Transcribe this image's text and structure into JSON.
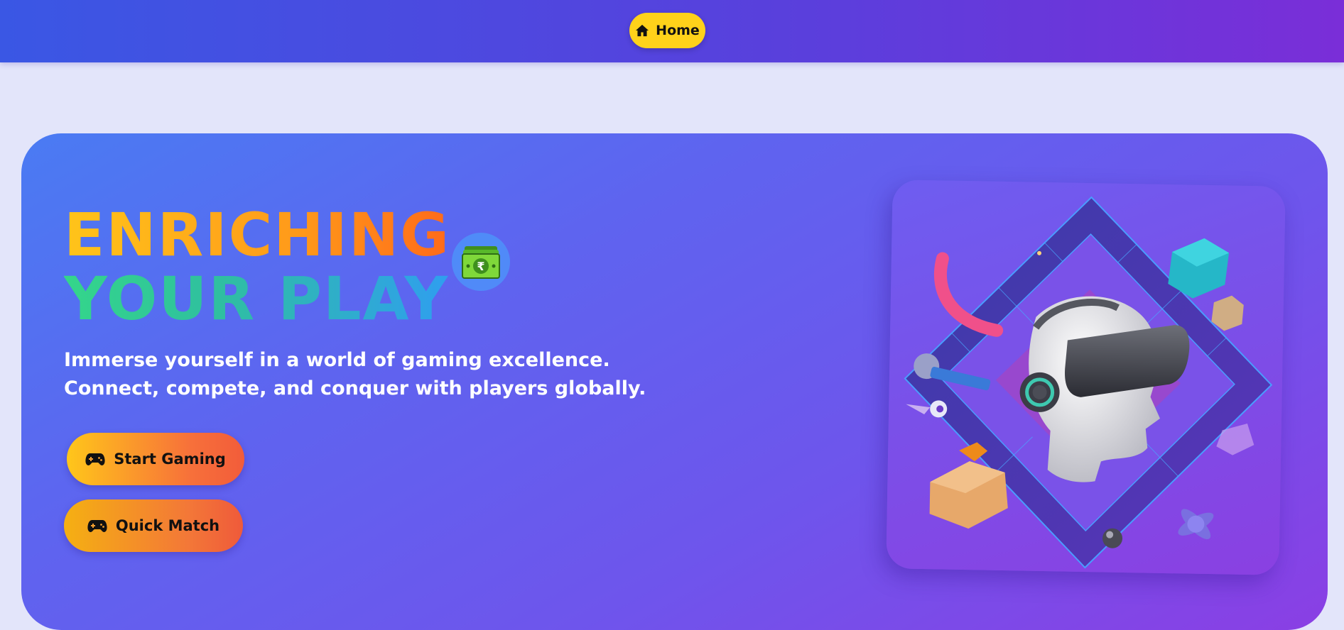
{
  "nav": {
    "home_label": "Home",
    "home_icon": "home-icon",
    "bar_colors": [
      "#3a57e4",
      "#7a2ed8"
    ],
    "button_color": "#ffd21a"
  },
  "hero": {
    "title_line1": "ENRICHING",
    "title_line2": "YOUR PLAY",
    "title_line1_colors": [
      "#ffc41a",
      "#ff6a1a"
    ],
    "title_line2_colors": [
      "#34d68a",
      "#2f9ef0"
    ],
    "badge_icon": "rupee-money-icon",
    "subtitle_line1": "Immerse yourself in a world of gaming excellence.",
    "subtitle_line2": "Connect, compete, and conquer with players globally.",
    "buttons": [
      {
        "label": "Start Gaming",
        "icon": "gamepad-icon"
      },
      {
        "label": "Quick Match",
        "icon": "gamepad-icon"
      }
    ],
    "background_colors": [
      "#4a7bf3",
      "#8a3fe4"
    ]
  },
  "illustration": {
    "name": "vr-headset-head-illustration"
  }
}
